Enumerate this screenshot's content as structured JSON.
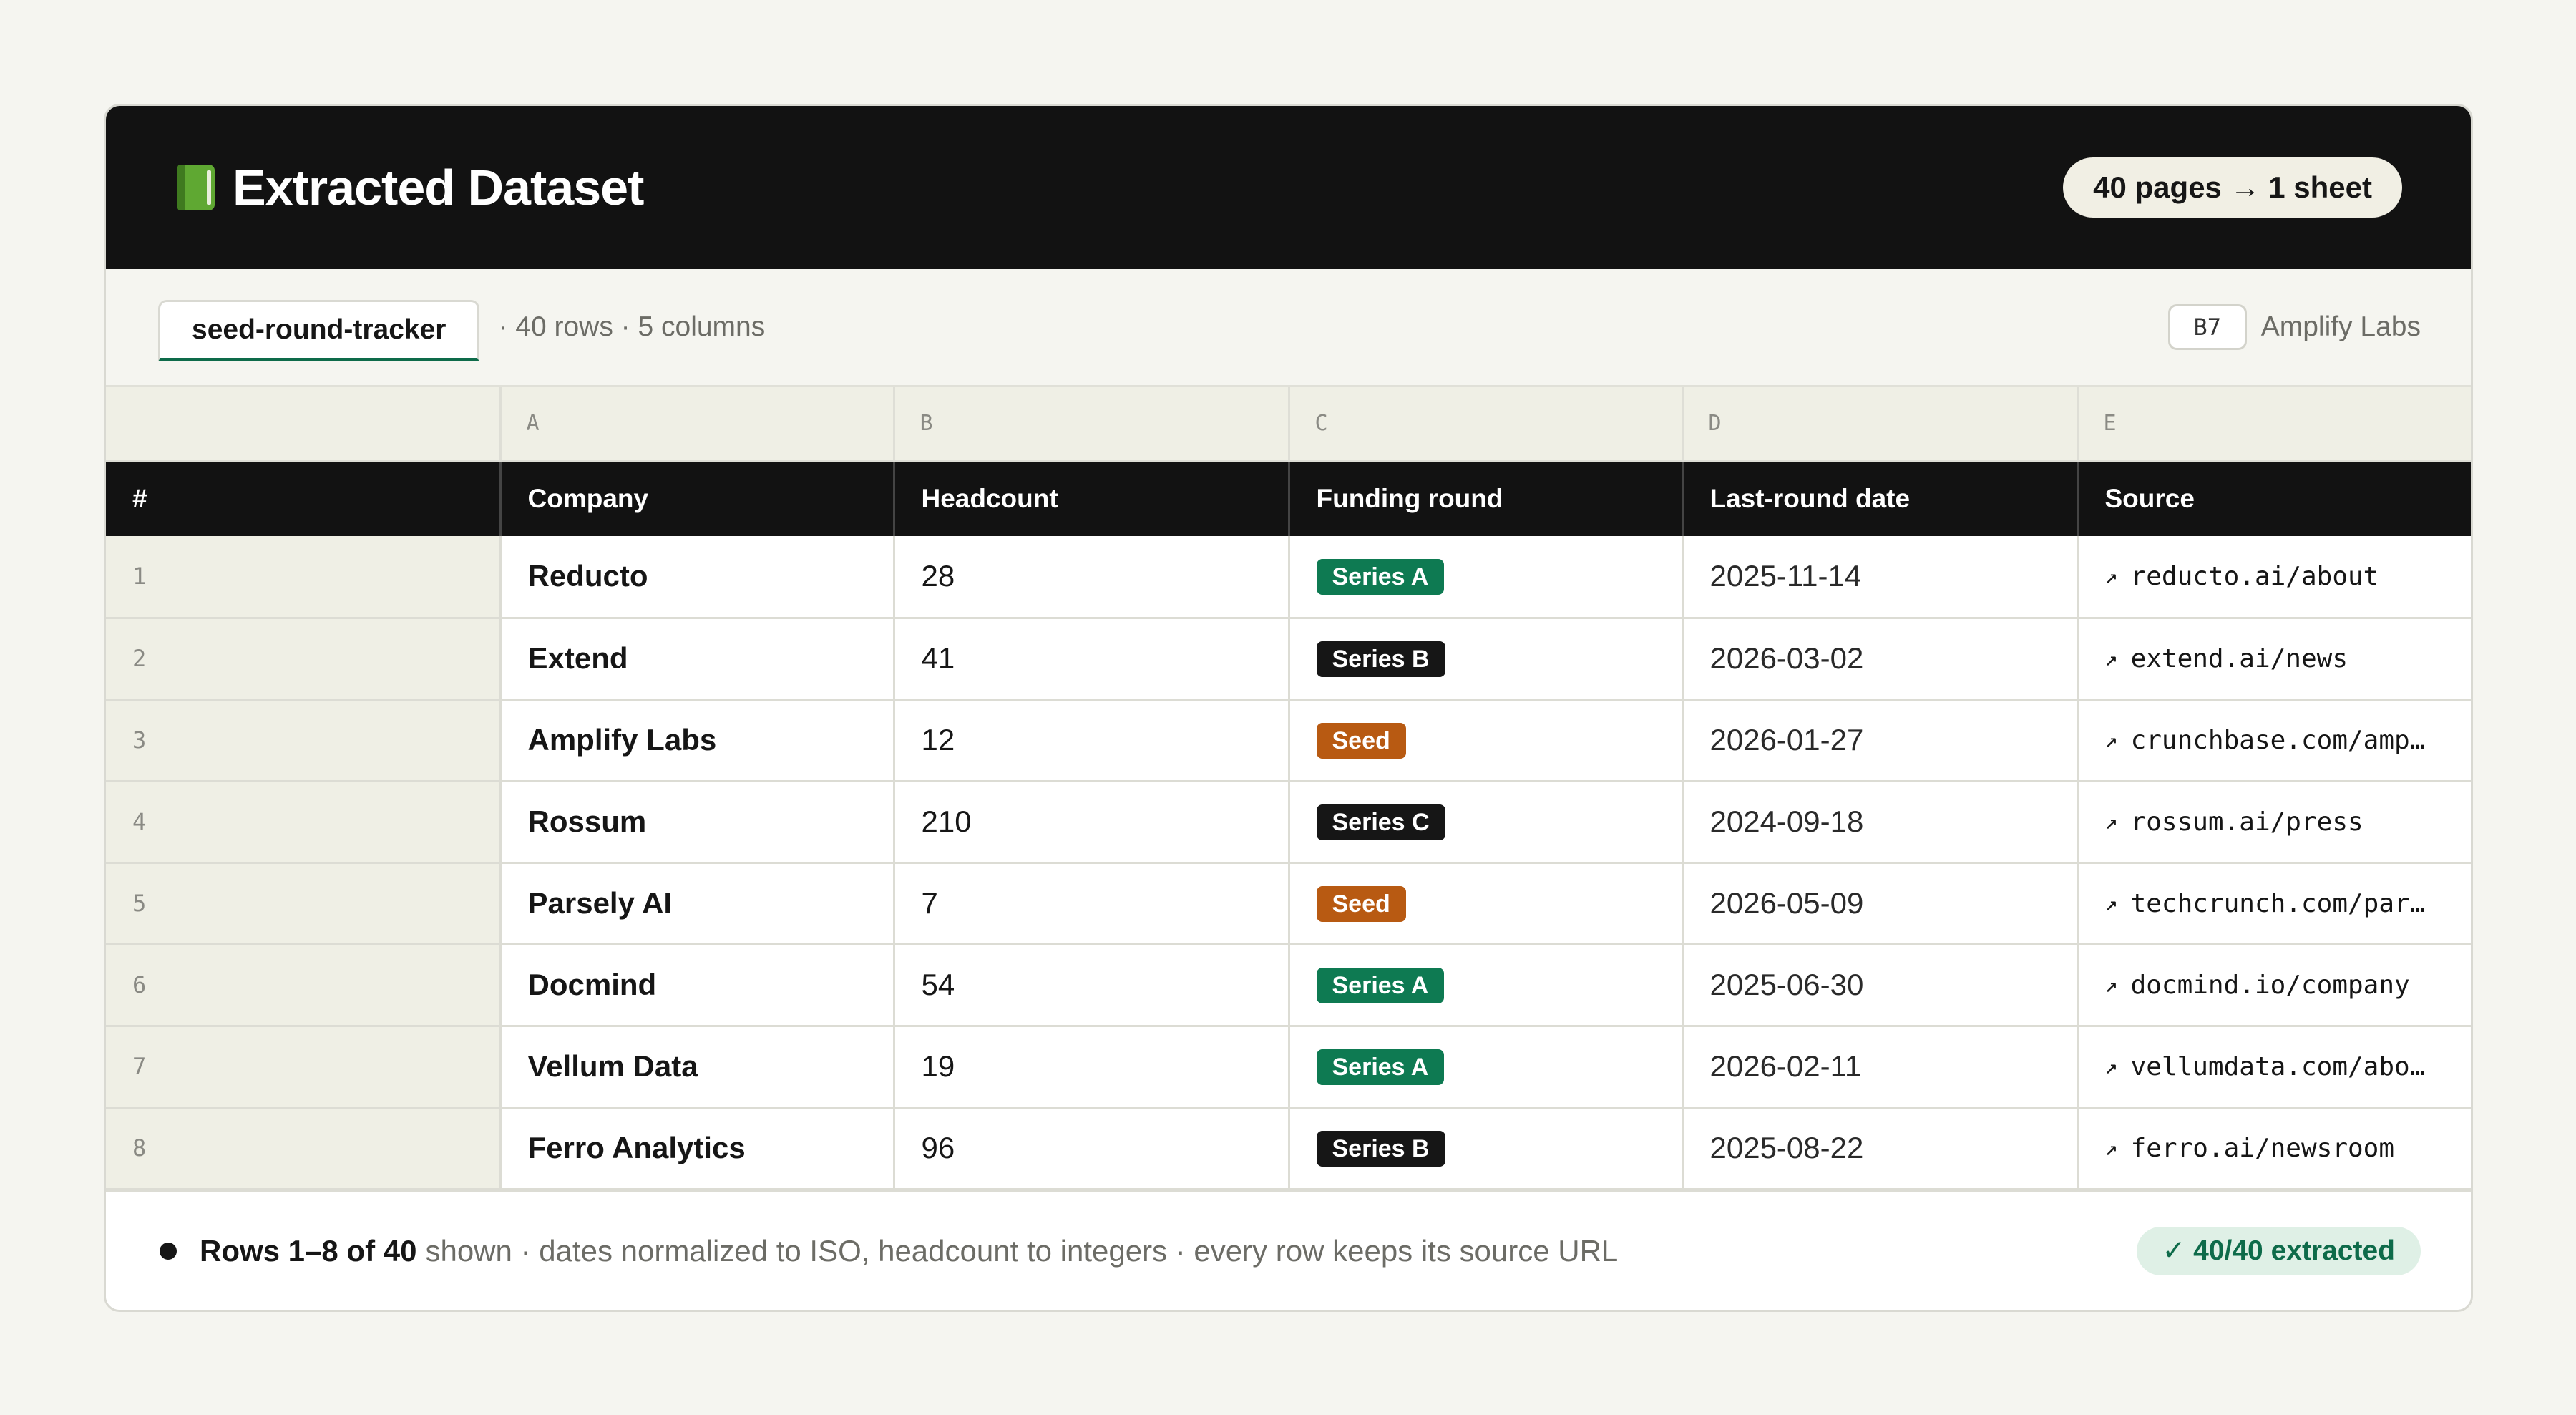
{
  "header": {
    "title": "Extracted Dataset",
    "icon": "green-book-icon",
    "pages_pill": "40 pages → 1 sheet"
  },
  "toolbar": {
    "sheet_tab": "seed-round-tracker",
    "meta": "· 40 rows · 5 columns",
    "cell_ref": "B7",
    "cell_value": "Amplify Labs"
  },
  "table": {
    "column_letters": [
      "",
      "A",
      "B",
      "C",
      "D",
      "E"
    ],
    "headers": [
      "#",
      "Company",
      "Headcount",
      "Funding round",
      "Last-round date",
      "Source"
    ],
    "rows": [
      {
        "num": "1",
        "company": "Reducto",
        "headcount": "28",
        "round": "Series A",
        "round_color": "#0e7a52",
        "date": "2025-11-14",
        "source": "reducto.ai/about"
      },
      {
        "num": "2",
        "company": "Extend",
        "headcount": "41",
        "round": "Series B",
        "round_color": "#161616",
        "date": "2026-03-02",
        "source": "extend.ai/news"
      },
      {
        "num": "3",
        "company": "Amplify Labs",
        "headcount": "12",
        "round": "Seed",
        "round_color": "#b85a12",
        "date": "2026-01-27",
        "source": "crunchbase.com/amp…"
      },
      {
        "num": "4",
        "company": "Rossum",
        "headcount": "210",
        "round": "Series C",
        "round_color": "#161616",
        "date": "2024-09-18",
        "source": "rossum.ai/press"
      },
      {
        "num": "5",
        "company": "Parsely AI",
        "headcount": "7",
        "round": "Seed",
        "round_color": "#b85a12",
        "date": "2026-05-09",
        "source": "techcrunch.com/par…"
      },
      {
        "num": "6",
        "company": "Docmind",
        "headcount": "54",
        "round": "Series A",
        "round_color": "#0e7a52",
        "date": "2025-06-30",
        "source": "docmind.io/company"
      },
      {
        "num": "7",
        "company": "Vellum Data",
        "headcount": "19",
        "round": "Series A",
        "round_color": "#0e7a52",
        "date": "2026-02-11",
        "source": "vellumdata.com/abo…"
      },
      {
        "num": "8",
        "company": "Ferro Analytics",
        "headcount": "96",
        "round": "Series B",
        "round_color": "#161616",
        "date": "2025-08-22",
        "source": "ferro.ai/newsroom"
      }
    ]
  },
  "footer": {
    "rows_strong": "Rows 1–8 of 40",
    "rows_rest": "shown · dates normalized to ISO, headcount to integers · every row keeps its source URL",
    "extracted": "✓ 40/40 extracted"
  },
  "colors": {
    "accent": "#0e6b4a",
    "header_bg": "#121212",
    "seed": "#b85a12",
    "series_a": "#0e7a52",
    "series_dark": "#161616"
  }
}
